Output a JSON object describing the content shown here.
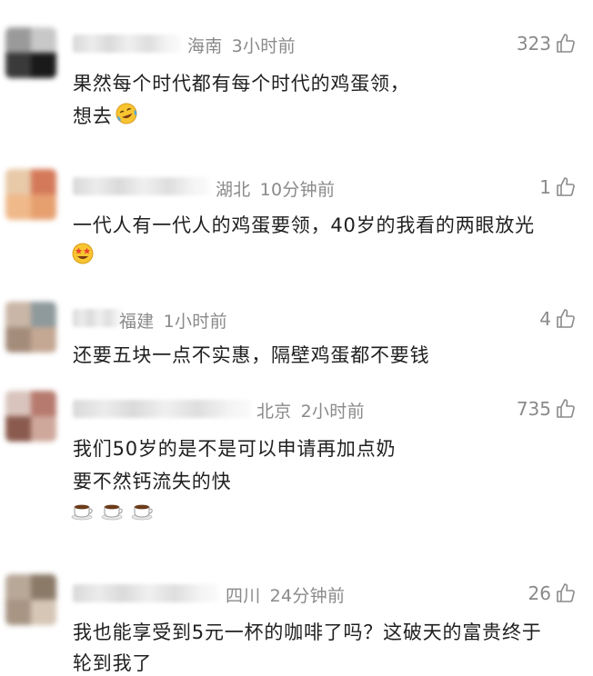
{
  "comments": [
    {
      "location": "海南",
      "time": "3小时前",
      "likes": "323",
      "lines": [
        "果然每个时代都有每个时代的鸡蛋领，",
        "想去"
      ],
      "emoji": "crying-laughing-emoji"
    },
    {
      "location": "湖北",
      "time": "10分钟前",
      "likes": "1",
      "lines": [
        "一代人有一代人的鸡蛋要领，40岁的我看的两眼放光"
      ],
      "emoji": "star-struck-emoji"
    },
    {
      "location": "福建",
      "time": "1小时前",
      "likes": "4",
      "lines": [
        "还要五块一点不实惠，隔壁鸡蛋都不要钱"
      ]
    },
    {
      "location": "北京",
      "time": "2小时前",
      "likes": "735",
      "lines": [
        "我们50岁的是不是可以申请再加点奶",
        "要不然钙流失的快"
      ],
      "emoji": "coffee-cup-emoji"
    },
    {
      "location": "四川",
      "time": "24分钟前",
      "likes": "26",
      "lines": [
        "我也能享受到5元一杯的咖啡了吗？这破天的富贵终于",
        "轮到我了"
      ]
    }
  ],
  "icons": {
    "like": "thumbs-up-outline-icon"
  },
  "colors": {
    "text": "#1f1f1f",
    "meta": "#8a8a8a",
    "background": "#ffffff"
  }
}
